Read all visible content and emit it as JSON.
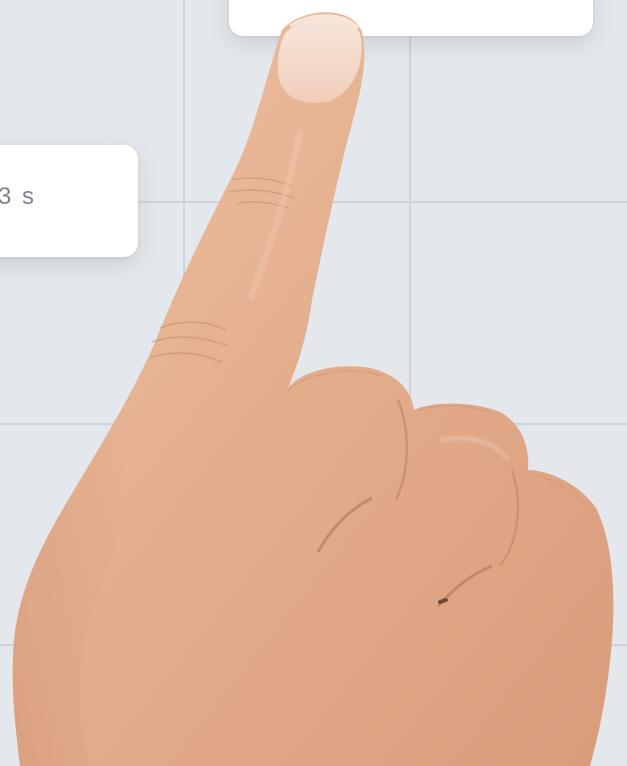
{
  "scene": {
    "background_color": "#e4e8ec",
    "grid_color": "#d0d4d9",
    "skin_color": "#e6b394"
  },
  "cards": {
    "top_card": {
      "text": ""
    },
    "left_card": {
      "text": "3 s"
    }
  },
  "photo": {
    "subject": "hand-pointing-index-finger-icon"
  }
}
